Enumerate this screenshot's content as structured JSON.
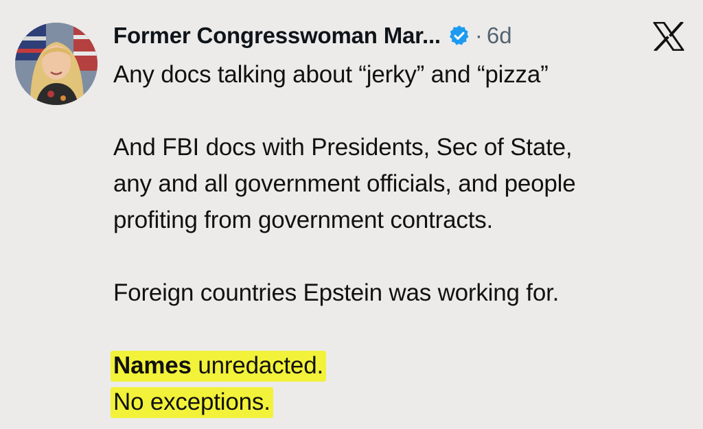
{
  "post": {
    "author_name": "Former Congresswoman Mar...",
    "separator": "·",
    "timestamp": "6d",
    "icons": {
      "verified": "verified-badge-icon",
      "platform": "x-logo-icon"
    },
    "lines": [
      "Any docs talking about “jerky” and “pizza”",
      "And FBI docs with Presidents, Sec of State,",
      "any and all government officials, and people",
      "profiting from government contracts.",
      "Foreign countries Epstein was working for."
    ],
    "highlighted": {
      "word_bold": "Names",
      "rest": " unredacted.",
      "line2": "No exceptions."
    }
  },
  "colors": {
    "background": "#ecebea",
    "text": "#111111",
    "muted": "#536471",
    "verified": "#1d9bf0",
    "highlight": "#f2f23a"
  }
}
